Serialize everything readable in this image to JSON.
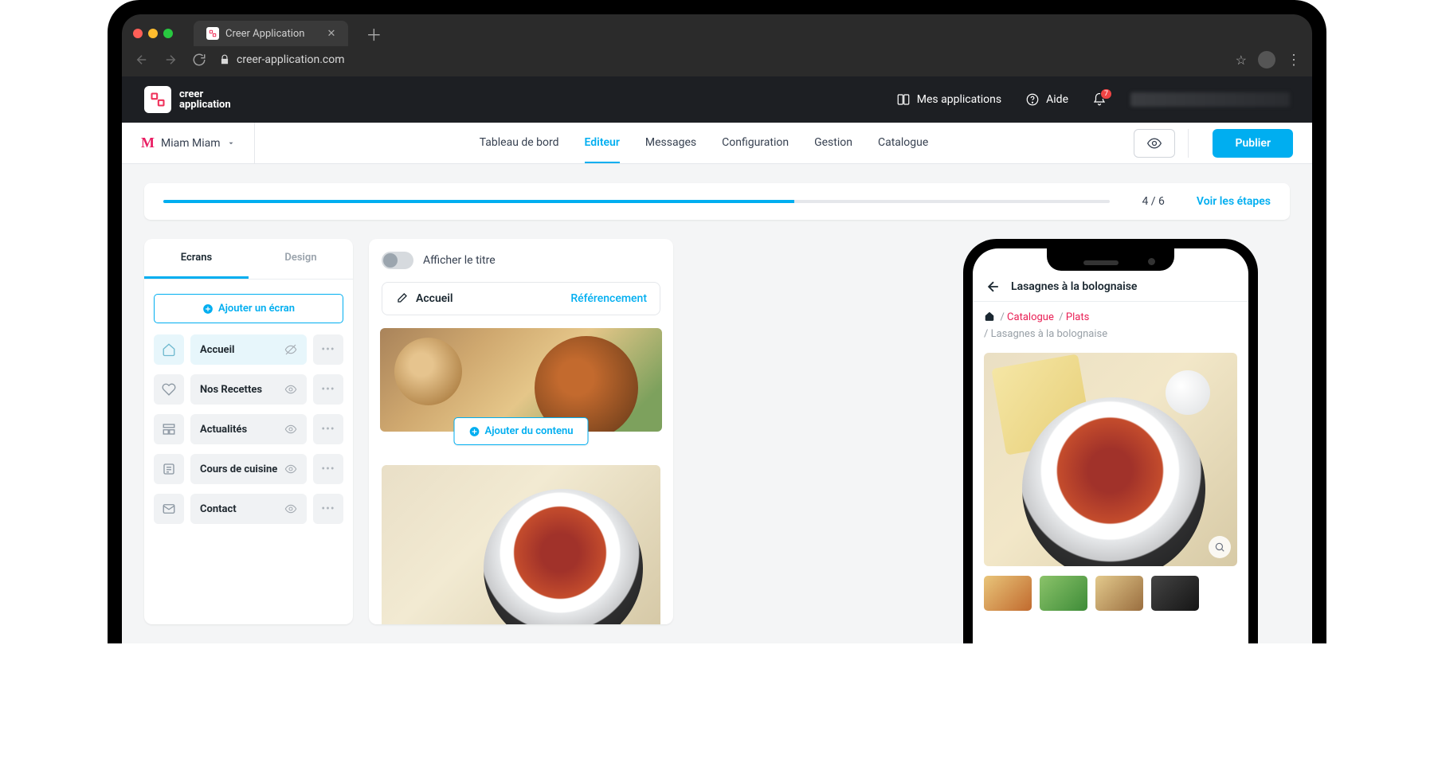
{
  "browser": {
    "tab_title": "Creer Application",
    "url": "creer-application.com"
  },
  "header": {
    "logo_line1": "creer",
    "logo_line2": "application",
    "my_apps": "Mes applications",
    "help": "Aide",
    "notif_count": "7"
  },
  "nav": {
    "app_name": "Miam Miam",
    "tabs": {
      "dashboard": "Tableau de bord",
      "editor": "Editeur",
      "messages": "Messages",
      "config": "Configuration",
      "manage": "Gestion",
      "catalog": "Catalogue"
    },
    "publish": "Publier"
  },
  "progress": {
    "count": "4 / 6",
    "link": "Voir les étapes",
    "percent": 66.66
  },
  "sidebar": {
    "tab_screens": "Ecrans",
    "tab_design": "Design",
    "add_screen": "Ajouter un écran",
    "screens": [
      {
        "label": "Accueil"
      },
      {
        "label": "Nos Recettes"
      },
      {
        "label": "Actualités"
      },
      {
        "label": "Cours de cuisine"
      },
      {
        "label": "Contact"
      }
    ]
  },
  "editor": {
    "toggle": "Afficher le titre",
    "title": "Accueil",
    "seo": "Référencement",
    "add_content": "Ajouter du contenu"
  },
  "phone": {
    "title": "Lasagnes à la bolognaise",
    "crumb1": "Catalogue",
    "crumb2": "Plats",
    "crumb3": "Lasagnes à la bolognaise"
  }
}
